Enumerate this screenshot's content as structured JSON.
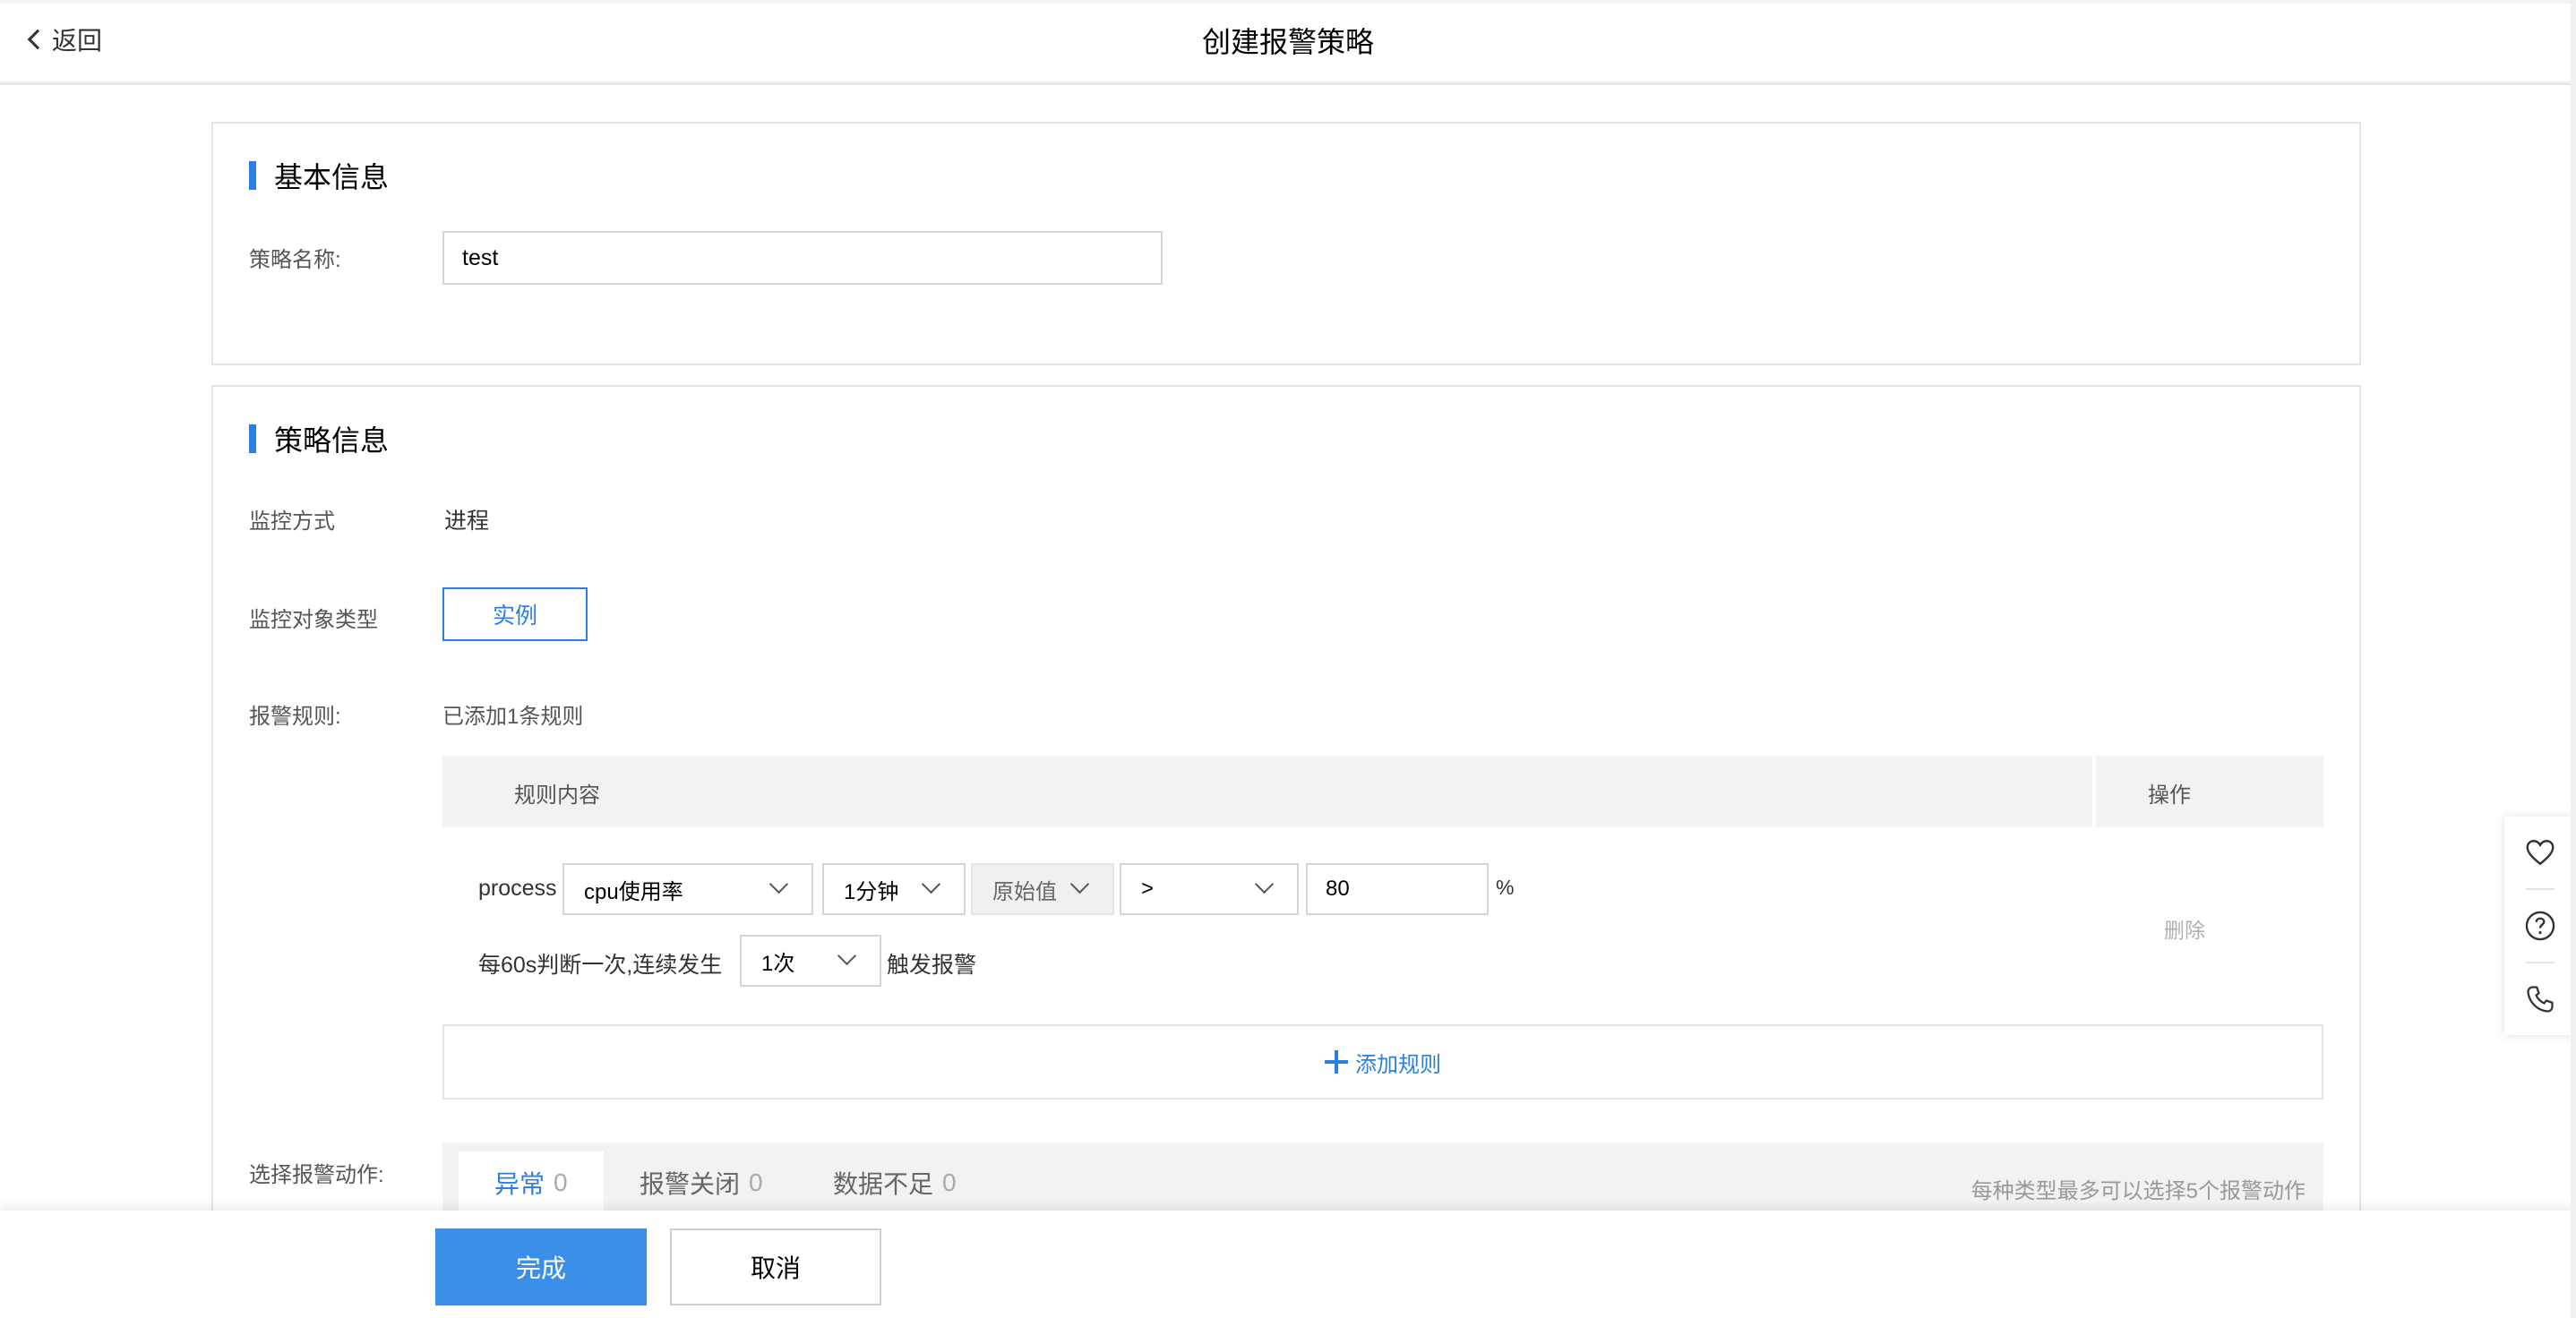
{
  "header": {
    "back_label": "返回",
    "title": "创建报警策略"
  },
  "basic_info": {
    "section_title": "基本信息",
    "name_label": "策略名称:",
    "name_value": "test"
  },
  "strategy_info": {
    "section_title": "策略信息",
    "monitor_method_label": "监控方式",
    "monitor_method_value": "进程",
    "monitor_object_label": "监控对象类型",
    "monitor_object_button": "实例",
    "alarm_rules_label": "报警规则:",
    "alarm_rules_summary": "已添加1条规则"
  },
  "rule_table": {
    "col_content": "规则内容",
    "col_action": "操作",
    "rule": {
      "prefix": "process",
      "metric": "cpu使用率",
      "period": "1分钟",
      "stat": "原始值",
      "operator": ">",
      "threshold": "80",
      "unit": "%",
      "judge_text": "每60s判断一次,连续发生",
      "times": "1次",
      "trigger_text": "触发报警",
      "delete_label": "删除"
    },
    "add_rule_label": "添加规则"
  },
  "alarm_actions": {
    "label": "选择报警动作:",
    "tabs": [
      {
        "label": "异常",
        "count": "0"
      },
      {
        "label": "报警关闭",
        "count": "0"
      },
      {
        "label": "数据不足",
        "count": "0"
      }
    ],
    "note": "每种类型最多可以选择5个报警动作"
  },
  "footer": {
    "submit_label": "完成",
    "cancel_label": "取消"
  },
  "float_toolbar": {
    "icons": [
      "heart-icon",
      "help-icon",
      "phone-icon"
    ]
  },
  "colors": {
    "accent": "#2b7fe0",
    "primary_button": "#3b8fe8"
  }
}
